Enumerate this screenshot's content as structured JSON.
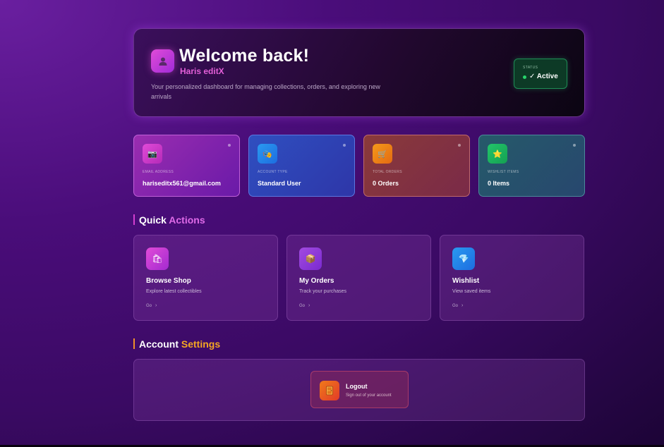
{
  "hero": {
    "title": "Welcome back!",
    "username": "Haris editX",
    "description": "Your personalized dashboard for managing collections, orders, and exploring new arrivals",
    "avatar_icon": "user-icon",
    "status_label": "STATUS",
    "status_value": "✓ Active",
    "status_color": "#27d36b"
  },
  "info_cards": [
    {
      "icon": "camera-icon",
      "glyph": "📷",
      "label": "EMAIL ADDRESS",
      "value": "hariseditx561@gmail.com",
      "color": "#e14bd8"
    },
    {
      "icon": "mask-icon",
      "glyph": "🎭",
      "label": "ACCOUNT TYPE",
      "value": "Standard User",
      "color": "#2a9af0"
    },
    {
      "icon": "cart-icon",
      "glyph": "🛒",
      "label": "TOTAL ORDERS",
      "value": "0 Orders",
      "color": "#f59a1a"
    },
    {
      "icon": "star-icon",
      "glyph": "⭐",
      "label": "WISHLIST ITEMS",
      "value": "0 Items",
      "color": "#22c56a"
    }
  ],
  "quick_actions": {
    "title_main": "Quick",
    "title_accent": "Actions",
    "items": [
      {
        "icon": "shopping-bags-icon",
        "glyph": "🛍",
        "title": "Browse Shop",
        "desc": "Explore latest collectibles",
        "go": "Go"
      },
      {
        "icon": "package-icon",
        "glyph": "📦",
        "title": "My Orders",
        "desc": "Track your purchases",
        "go": "Go"
      },
      {
        "icon": "gem-icon",
        "glyph": "💎",
        "title": "Wishlist",
        "desc": "View saved items",
        "go": "Go"
      }
    ]
  },
  "account_settings": {
    "title_main": "Account",
    "title_accent": "Settings",
    "logout": {
      "icon": "door-icon",
      "title": "Logout",
      "desc": "Sign out of your account"
    }
  }
}
